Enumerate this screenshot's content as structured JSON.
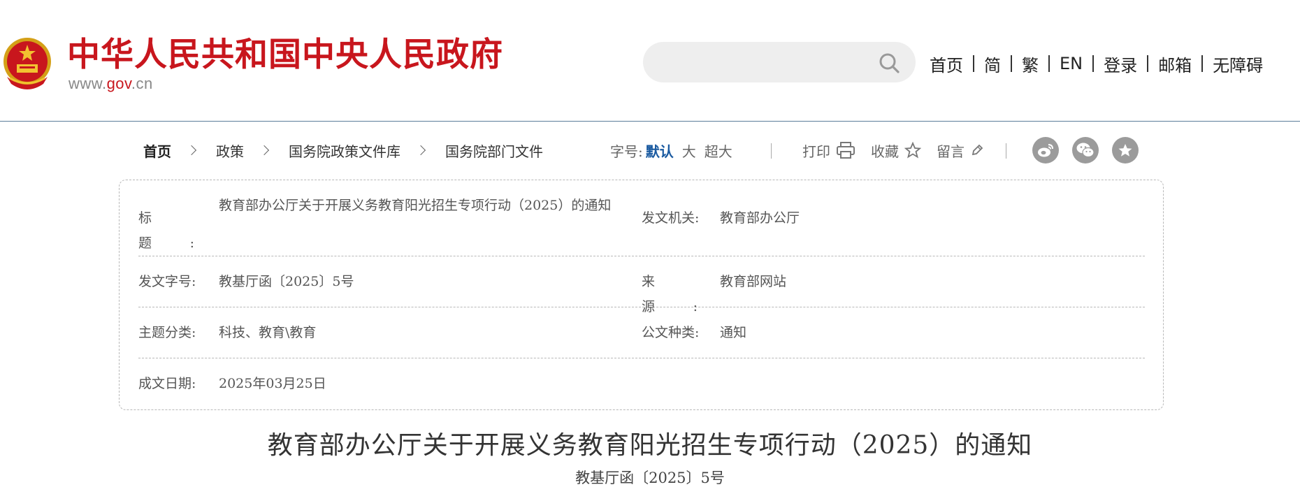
{
  "header": {
    "site_title": "中华人民共和国中央人民政府",
    "domain_prefix": "www.",
    "domain_gov": "gov",
    "domain_suffix": ".cn",
    "search": {
      "placeholder": "",
      "value": ""
    },
    "nav": [
      "首页",
      "简",
      "繁",
      "EN",
      "登录",
      "邮箱",
      "无障碍"
    ],
    "colors": {
      "brand_red": "#c8161d",
      "divider": "#5b7c99"
    }
  },
  "breadcrumb": [
    "首页",
    "政策",
    "国务院政策文件库",
    "国务院部门文件"
  ],
  "font_size": {
    "label": "字号:",
    "options": [
      "默认",
      "大",
      "超大"
    ],
    "active": "默认",
    "active_color": "#1a5aa0"
  },
  "tools": [
    {
      "label": "打印",
      "icon": "printer-icon"
    },
    {
      "label": "收藏",
      "icon": "star-outline-icon"
    },
    {
      "label": "留言",
      "icon": "pencil-icon"
    }
  ],
  "share": [
    "weibo-icon",
    "wechat-icon",
    "favorite-star-icon"
  ],
  "info": {
    "title_label": "标　　题:",
    "title_value": "教育部办公厅关于开展义务教育阳光招生专项行动（2025）的通知",
    "issuer_label": "发文机关:",
    "issuer_value": "教育部办公厅",
    "doc_no_label": "发文字号:",
    "doc_no_value": "教基厅函〔2025〕5号",
    "source_label": "来　　源:",
    "source_value": "教育部网站",
    "topic_label": "主题分类:",
    "topic_value": "科技、教育\\教育",
    "type_label": "公文种类:",
    "type_value": "通知",
    "date_label": "成文日期:",
    "date_value": "2025年03月25日"
  },
  "document": {
    "title": "教育部办公厅关于开展义务教育阳光招生专项行动（2025）的通知",
    "number": "教基厅函〔2025〕5号"
  }
}
